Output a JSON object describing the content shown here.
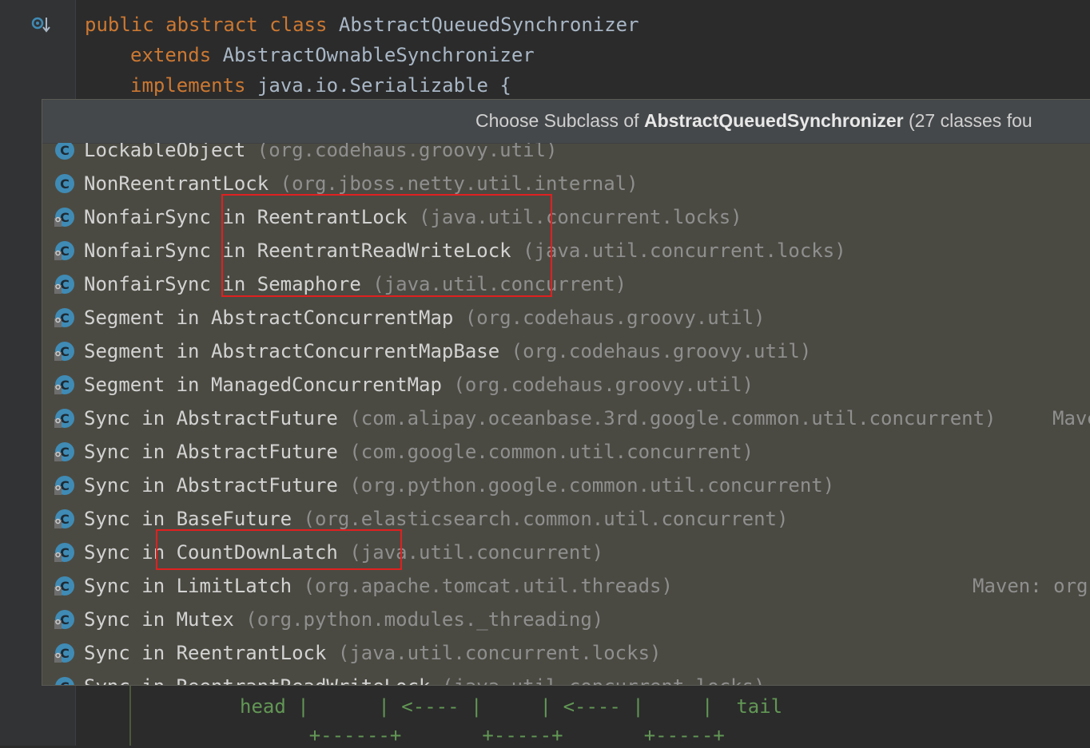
{
  "code": {
    "line1": {
      "kw": "public abstract class",
      "rest": " AbstractQueuedSynchronizer"
    },
    "line2": {
      "kw": "extends",
      "rest": " AbstractOwnableSynchronizer"
    },
    "line3": {
      "kw": "implements",
      "rest": " java.io.Serializable {"
    }
  },
  "popup": {
    "title_prefix": "Choose Subclass of ",
    "title_class": "AbstractQueuedSynchronizer",
    "title_suffix": " (27 classes fou",
    "items": [
      {
        "name": "LockableObject",
        "pkg": "(org.codehaus.groovy.util)",
        "lib": ""
      },
      {
        "name": "NonReentrantLock",
        "pkg": "(org.jboss.netty.util.internal)",
        "lib": ""
      },
      {
        "name": "NonfairSync in ReentrantLock",
        "pkg": "(java.util.concurrent.locks)",
        "lib": ""
      },
      {
        "name": "NonfairSync in ReentrantReadWriteLock",
        "pkg": "(java.util.concurrent.locks)",
        "lib": ""
      },
      {
        "name": "NonfairSync in Semaphore",
        "pkg": "(java.util.concurrent)",
        "lib": ""
      },
      {
        "name": "Segment in AbstractConcurrentMap",
        "pkg": "(org.codehaus.groovy.util)",
        "lib": ""
      },
      {
        "name": "Segment in AbstractConcurrentMapBase",
        "pkg": "(org.codehaus.groovy.util)",
        "lib": ""
      },
      {
        "name": "Segment in ManagedConcurrentMap",
        "pkg": "(org.codehaus.groovy.util)",
        "lib": ""
      },
      {
        "name": "Sync in AbstractFuture",
        "pkg": "(com.alipay.oceanbase.3rd.google.common.util.concurrent)",
        "lib": "Mave"
      },
      {
        "name": "Sync in AbstractFuture",
        "pkg": "(com.google.common.util.concurrent)",
        "lib": ""
      },
      {
        "name": "Sync in AbstractFuture",
        "pkg": "(org.python.google.common.util.concurrent)",
        "lib": ""
      },
      {
        "name": "Sync in BaseFuture",
        "pkg": "(org.elasticsearch.common.util.concurrent)",
        "lib": ""
      },
      {
        "name": "Sync in CountDownLatch",
        "pkg": "(java.util.concurrent)",
        "lib": ""
      },
      {
        "name": "Sync in LimitLatch",
        "pkg": "(org.apache.tomcat.util.threads)",
        "lib": "Maven: org"
      },
      {
        "name": "Sync in Mutex",
        "pkg": "(org.python.modules._threading)",
        "lib": ""
      },
      {
        "name": "Sync in ReentrantLock",
        "pkg": "(java.util.concurrent.locks)",
        "lib": ""
      },
      {
        "name": "Sync in ReentrantReadWriteLock",
        "pkg": "(java.util.concurrent.locks)",
        "lib": ""
      }
    ]
  },
  "bottom": {
    "line1": "head |      | <---- |     | <---- |     |  tail",
    "line2": "      +------+       +-----+       +-----+"
  },
  "colors": {
    "highlight": "#e02020",
    "icon": "#3f8bb5"
  }
}
